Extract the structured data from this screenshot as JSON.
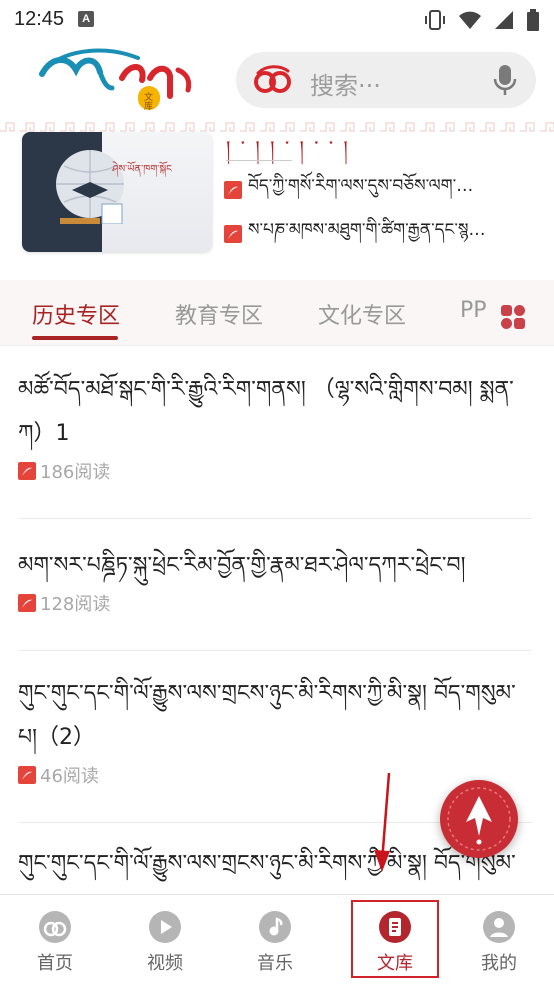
{
  "status_bar": {
    "time": "12:45",
    "notification_badge": "A"
  },
  "header": {
    "logo_subtitle": "文库",
    "search_placeholder": "搜索···"
  },
  "featured": {
    "top_text": "། ་ ། ། ་ ། ་ ་ །",
    "thumb_caption": "ཤེས་ཡོན་ཁག་སྐོང",
    "docs": [
      {
        "title": "བོད་ཀྱི་གསོ་རིག་ལས་དུས་བཅོས་ལག་…"
      },
      {
        "title": "ས་པཎ་མཁས་མཐུག་གི་ཚིག་རྒྱན་དང་སྙ…"
      }
    ]
  },
  "tabs": [
    {
      "label": "历史专区",
      "active": true
    },
    {
      "label": "教育专区",
      "active": false
    },
    {
      "label": "文化专区",
      "active": false
    },
    {
      "label": "PP",
      "active": false
    }
  ],
  "documents": [
    {
      "title": "མཚོ་བོད་མཐོ་སྒང་གི་རི་རྒྱུའི་རིག་གནས། （ལྷ་སའི་གླིགས་བམ། སྨན་ཀ）1",
      "reads": "186阅读"
    },
    {
      "title": "མག་སར་པཎྜིཏ་སྐུ་ཕྲེང་རིམ་བྱོན་གྱི་རྣམ་ཐར་ཤེལ་དཀར་ཕྲེང་བ།",
      "reads": "128阅读"
    },
    {
      "title": "གུང་གུང་དང་གི་ལོ་རྒྱུས་ལས་གྲངས་ཉུང་མི་རིགས་ཀྱི་མི་སྣ། བོད་གསུམ་པ།（2）",
      "reads": "46阅读"
    },
    {
      "title": "གུང་གུང་དང་གི་ལོ་རྒྱུས་ལས་གྲངས་ཉུང་མི་རིགས་ཀྱི་མི་སྣ། བོད་གསུམ་པ།",
      "reads": ""
    }
  ],
  "bottom_nav": [
    {
      "label": "首页",
      "icon": "home-icon",
      "active": false
    },
    {
      "label": "视频",
      "icon": "video-icon",
      "active": false
    },
    {
      "label": "音乐",
      "icon": "music-icon",
      "active": false
    },
    {
      "label": "文库",
      "icon": "library-icon",
      "active": true
    },
    {
      "label": "我的",
      "icon": "profile-icon",
      "active": false
    }
  ],
  "colors": {
    "accent": "#a82424",
    "nav_active": "#b3262e",
    "fab": "#c82d35",
    "search_bg": "#eeeeee"
  }
}
